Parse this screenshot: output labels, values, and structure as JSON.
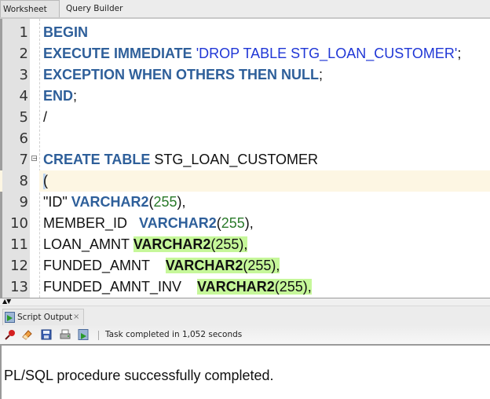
{
  "tabs": [
    {
      "label": "Worksheet",
      "active": true
    },
    {
      "label": "Query Builder",
      "active": false
    }
  ],
  "editor": {
    "lines": [
      {
        "n": "1",
        "tokens": [
          {
            "t": "BEGIN",
            "c": "kw"
          }
        ]
      },
      {
        "n": "2",
        "tokens": [
          {
            "t": "EXECUTE IMMEDIATE ",
            "c": "kw"
          },
          {
            "t": "'DROP TABLE STG_LOAN_CUSTOMER'",
            "c": "str"
          },
          {
            "t": ";",
            "c": ""
          }
        ]
      },
      {
        "n": "3",
        "tokens": [
          {
            "t": "EXCEPTION WHEN OTHERS THEN NULL",
            "c": "kw"
          },
          {
            "t": ";",
            "c": ""
          }
        ]
      },
      {
        "n": "4",
        "tokens": [
          {
            "t": "END",
            "c": "kw"
          },
          {
            "t": ";",
            "c": ""
          }
        ]
      },
      {
        "n": "5",
        "tokens": [
          {
            "t": "/",
            "c": ""
          }
        ]
      },
      {
        "n": "6",
        "tokens": []
      },
      {
        "n": "7",
        "fold": true,
        "tokens": [
          {
            "t": "CREATE TABLE ",
            "c": "kw"
          },
          {
            "t": "STG_LOAN_CUSTOMER",
            "c": ""
          }
        ]
      },
      {
        "n": "8",
        "current": true,
        "tokens": [
          {
            "t": "(",
            "c": "",
            "cursor": true
          }
        ]
      },
      {
        "n": "9",
        "tokens": [
          {
            "t": "\"ID\" ",
            "c": ""
          },
          {
            "t": "VARCHAR2",
            "c": "kw"
          },
          {
            "t": "(",
            "c": ""
          },
          {
            "t": "255",
            "c": "num"
          },
          {
            "t": "),",
            "c": ""
          }
        ]
      },
      {
        "n": "10",
        "tokens": [
          {
            "t": "MEMBER_ID   ",
            "c": ""
          },
          {
            "t": "VARCHAR2",
            "c": "kw"
          },
          {
            "t": "(",
            "c": ""
          },
          {
            "t": "255",
            "c": "num"
          },
          {
            "t": "),",
            "c": ""
          }
        ]
      },
      {
        "n": "11",
        "tokens": [
          {
            "t": "LOAN_AMNT ",
            "c": ""
          },
          {
            "t": "VARCHAR2",
            "c": "kw",
            "hl": true
          },
          {
            "t": "(255),",
            "c": "",
            "hl": true
          }
        ]
      },
      {
        "n": "12",
        "tokens": [
          {
            "t": "FUNDED_AMNT    ",
            "c": ""
          },
          {
            "t": "VARCHAR2",
            "c": "kw",
            "hl": true
          },
          {
            "t": "(255),",
            "c": "",
            "hl": true
          }
        ]
      },
      {
        "n": "13",
        "tokens": [
          {
            "t": "FUNDED_AMNT_INV    ",
            "c": ""
          },
          {
            "t": "VARCHAR2",
            "c": "kw",
            "hl": true
          },
          {
            "t": "(255),",
            "c": "",
            "hl": true
          }
        ]
      }
    ]
  },
  "output_panel": {
    "tab_label": "Script Output",
    "close_glyph": "×",
    "toolbar_icons": [
      "pin-icon",
      "eraser-icon",
      "save-icon",
      "print-icon",
      "run-script-icon"
    ],
    "status": "Task completed in 1,052 seconds",
    "message": "PL/SQL procedure successfully completed."
  },
  "splitter": {
    "arrows": "▲▼"
  }
}
